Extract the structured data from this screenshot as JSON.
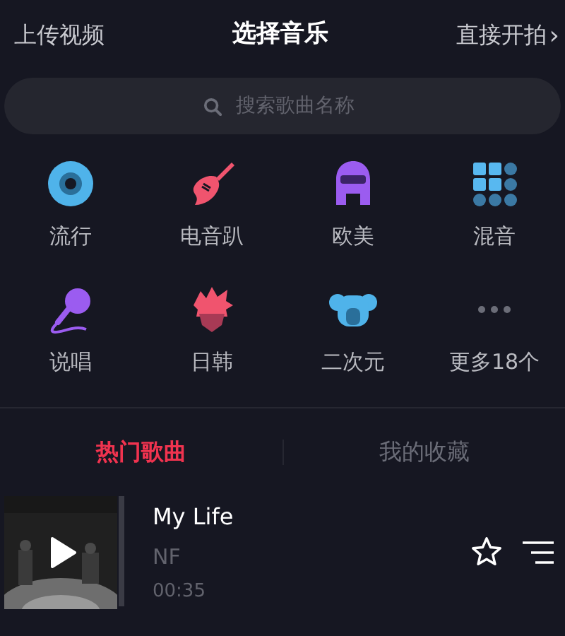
{
  "header": {
    "left": "上传视频",
    "title": "选择音乐",
    "right": "直接开拍",
    "right_arrow": "›"
  },
  "search": {
    "placeholder": "搜索歌曲名称"
  },
  "categories": [
    {
      "kind": "disc",
      "label": "流行"
    },
    {
      "kind": "guitar",
      "label": "电音趴"
    },
    {
      "kind": "singer",
      "label": "欧美"
    },
    {
      "kind": "grid",
      "label": "混音"
    },
    {
      "kind": "mic",
      "label": "说唱"
    },
    {
      "kind": "hair",
      "label": "日韩"
    },
    {
      "kind": "koala",
      "label": "二次元"
    },
    {
      "kind": "more",
      "label": "更多18个"
    }
  ],
  "tabs": [
    {
      "label": "热门歌曲",
      "selected": true
    },
    {
      "label": "我的收藏",
      "selected": false
    }
  ],
  "songs": [
    {
      "title": "My Life",
      "artist": "NF",
      "duration": "00:35"
    }
  ]
}
